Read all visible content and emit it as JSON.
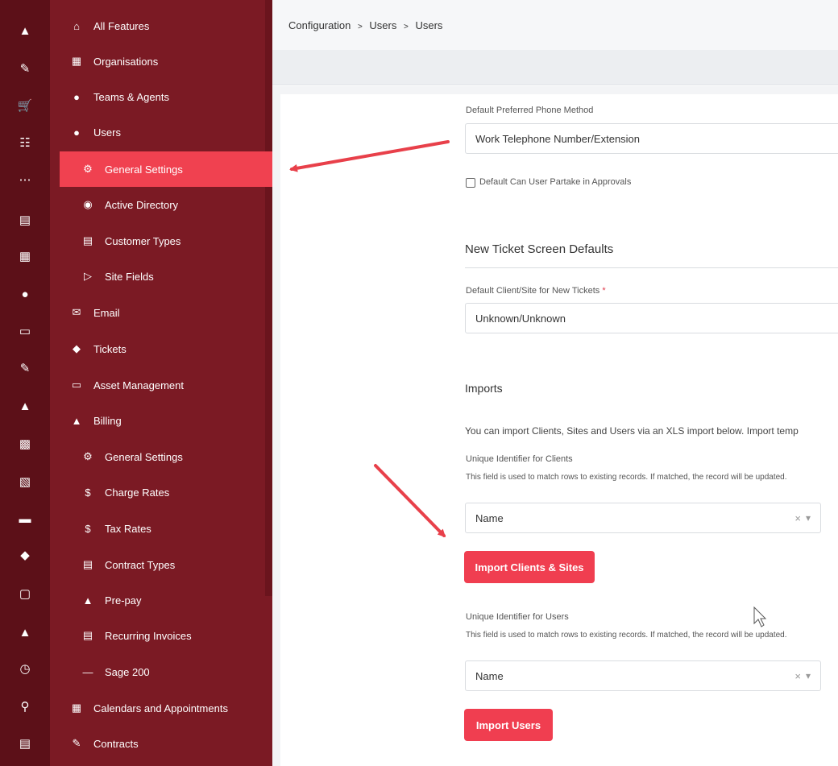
{
  "breadcrumb": {
    "item1": "Configuration",
    "item2": "Users",
    "item3": "Users",
    "separator": ">"
  },
  "rail": {
    "icons": [
      "warning-icon",
      "edit-icon",
      "cart-icon",
      "sitemap-icon",
      "more-icon",
      "chart-icon",
      "calendar-icon",
      "user-icon",
      "laptop-icon",
      "note-icon",
      "thumbs-up-icon",
      "box-icon",
      "book-icon",
      "truck-icon",
      "cube-icon",
      "tablet-icon",
      "money-bag-icon",
      "clock-icon",
      "search-icon",
      "document-icon"
    ]
  },
  "nav": {
    "all_features": "All Features",
    "organisations": "Organisations",
    "teams_agents": "Teams & Agents",
    "users": "Users",
    "general_settings": "General Settings",
    "active_directory": "Active Directory",
    "customer_types": "Customer Types",
    "site_fields": "Site Fields",
    "email": "Email",
    "tickets": "Tickets",
    "asset_management": "Asset Management",
    "billing": "Billing",
    "billing_general_settings": "General Settings",
    "charge_rates": "Charge Rates",
    "tax_rates": "Tax Rates",
    "contract_types": "Contract Types",
    "pre_pay": "Pre-pay",
    "recurring_invoices": "Recurring Invoices",
    "sage_200": "Sage 200",
    "calendars": "Calendars and Appointments",
    "contracts": "Contracts"
  },
  "form": {
    "phone_method_label": "Default Preferred Phone Method",
    "phone_method_value": "Work Telephone Number/Extension",
    "approvals_checkbox_label": "Default Can User Partake in Approvals",
    "approvals_checked": false,
    "new_ticket_heading": "New Ticket Screen Defaults",
    "default_client_label": "Default Client/Site for New Tickets",
    "required_mark": "*",
    "default_client_value": "Unknown/Unknown",
    "imports_heading": "Imports",
    "imports_intro": "You can import Clients, Sites and Users via an XLS import below. Import temp",
    "clients_identifier_label": "Unique Identifier for Clients",
    "clients_identifier_desc": "This field is used to match rows to existing records. If matched, the record will be updated.",
    "clients_identifier_value": "Name",
    "import_clients_button": "Import Clients & Sites",
    "users_identifier_label": "Unique Identifier for Users",
    "users_identifier_desc": "This field is used to match rows to existing records. If matched, the record will be updated.",
    "users_identifier_value": "Name",
    "import_users_button": "Import Users",
    "clear_glyph": "×",
    "dropdown_glyph": "▾"
  },
  "colors": {
    "rail_bg": "#5c1018",
    "nav_bg": "#7b1a24",
    "nav_active": "#f04150",
    "button": "#f03e50",
    "arrow": "#e8404a"
  }
}
